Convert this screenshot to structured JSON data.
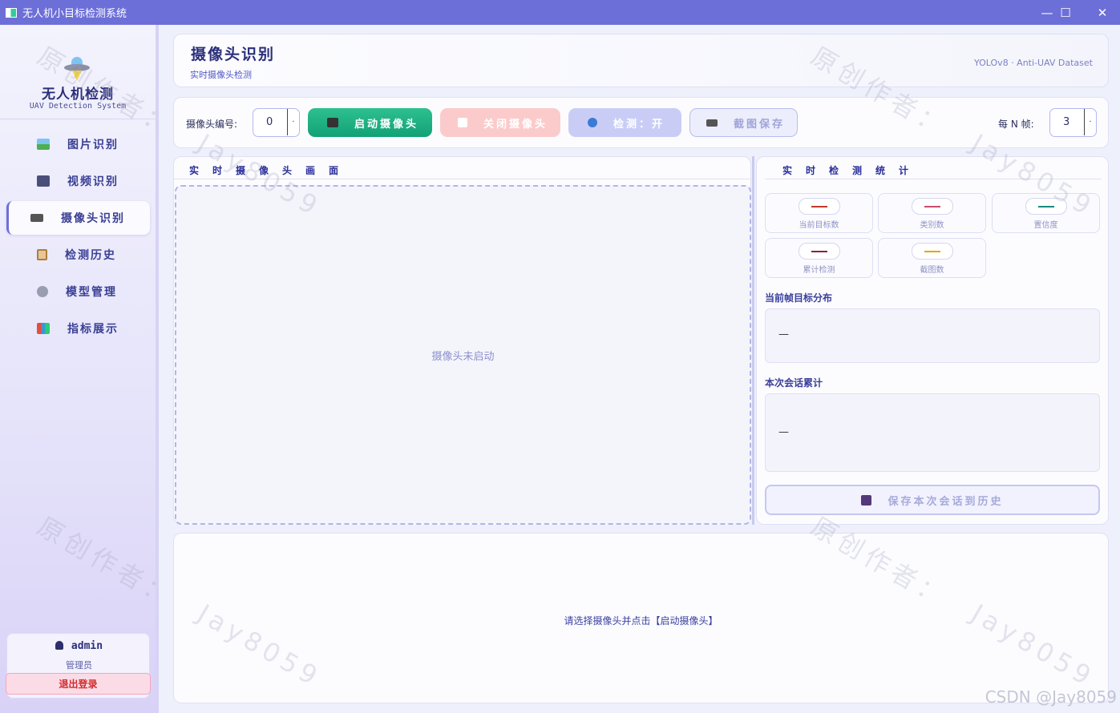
{
  "window": {
    "title": "无人机小目标检测系统",
    "controls": {
      "minimize": "—",
      "maximize": "☐",
      "close": "✕"
    }
  },
  "sidebar": {
    "logo_title": "无人机检测",
    "logo_subtitle": "UAV Detection System",
    "logo_icon": "ufo-icon",
    "items": [
      {
        "label": "图片识别",
        "icon": "image-icon",
        "active": false
      },
      {
        "label": "视频识别",
        "icon": "film-icon",
        "active": false
      },
      {
        "label": "摄像头识别",
        "icon": "camera-icon",
        "active": true
      },
      {
        "label": "检测历史",
        "icon": "clipboard-icon",
        "active": false
      },
      {
        "label": "模型管理",
        "icon": "gear-icon",
        "active": false
      },
      {
        "label": "指标展示",
        "icon": "bar-chart-icon",
        "active": false
      }
    ],
    "user": {
      "name": "admin",
      "role": "管理员",
      "logout_label": "退出登录",
      "icon": "user-icon"
    }
  },
  "header": {
    "title": "摄像头识别",
    "subtitle": "实时摄像头检测",
    "model_tag": "YOLOv8 · Anti-UAV Dataset"
  },
  "toolbar": {
    "camera_label": "摄像头编号:",
    "camera_value": "0",
    "start_label": "启动摄像头",
    "stop_label": "关闭摄像头",
    "detect_label": "检测：开",
    "screenshot_label": "截图保存",
    "every_n_label": "每 N 帧:",
    "every_n_value": "3",
    "spin_arrow": "·"
  },
  "camera_panel": {
    "title": "实时摄像头画面",
    "placeholder": "摄像头未启动"
  },
  "stats_panel": {
    "title": "实时检测统计",
    "cards": [
      {
        "label": "当前目标数",
        "value": "—",
        "color": "#c0392b"
      },
      {
        "label": "类别数",
        "value": "—",
        "color": "#c94d6d"
      },
      {
        "label": "置信度",
        "value": "—",
        "color": "#1a8a7a"
      },
      {
        "label": "累计检测",
        "value": "—",
        "color": "#8e1f3a"
      },
      {
        "label": "截图数",
        "value": "—",
        "color": "#e0a800"
      }
    ],
    "distribution_title": "当前帧目标分布",
    "distribution_value": "—",
    "session_title": "本次会话累计",
    "session_value": "—",
    "save_label": "保存本次会话到历史"
  },
  "log": {
    "message": "请选择摄像头并点击【启动摄像头】"
  },
  "watermarks": {
    "author": "原创作者：",
    "handle": "Jay8059",
    "csdn": "CSDN @Jay8059"
  }
}
